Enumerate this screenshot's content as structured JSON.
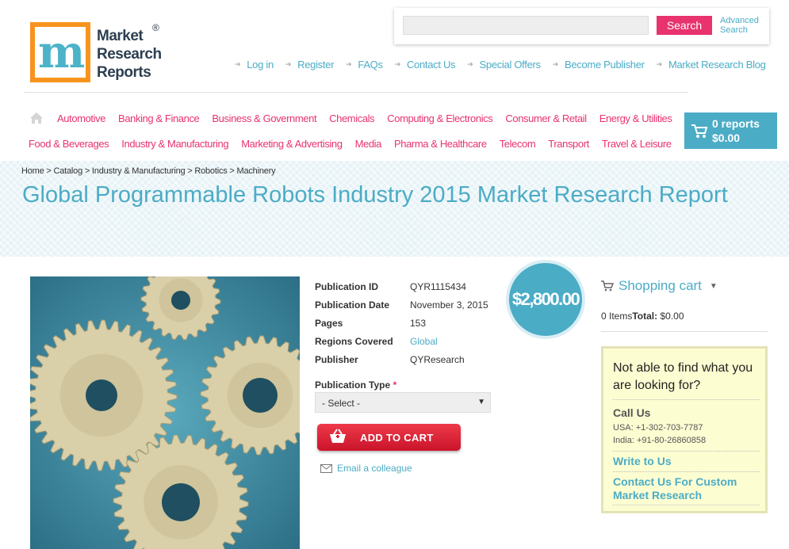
{
  "logo": {
    "text_lines": [
      "Market",
      "Research",
      "Reports"
    ],
    "registered": "®"
  },
  "search": {
    "placeholder": "",
    "button": "Search",
    "advanced": "Advanced Search"
  },
  "top_links": [
    "Log in",
    "Register",
    "FAQs",
    "Contact Us",
    "Special Offers",
    "Become Publisher",
    "Market Research Blog"
  ],
  "categories_row1": [
    "Automotive",
    "Banking & Finance",
    "Business & Government",
    "Chemicals",
    "Computing & Electronics",
    "Consumer & Retail",
    "Energy & Utilities"
  ],
  "categories_row2": [
    "Food & Beverages",
    "Industry & Manufacturing",
    "Marketing & Advertising",
    "Media",
    "Pharma & Healthcare",
    "Telecom",
    "Transport",
    "Travel & Leisure"
  ],
  "cart": {
    "reports": "0 reports",
    "total": "$0.00"
  },
  "breadcrumb": "Home > Catalog > Industry & Manufacturing > Robotics > Machinery",
  "title": "Global Programmable Robots Industry 2015 Market Research Report",
  "details": [
    {
      "label": "Publication ID",
      "value": "QYR1115434"
    },
    {
      "label": "Publication Date",
      "value": "November 3, 2015"
    },
    {
      "label": "Pages",
      "value": "153"
    },
    {
      "label": "Regions Covered",
      "value": "Global"
    },
    {
      "label": "Publisher",
      "value": "QYResearch"
    }
  ],
  "price": "$2,800.00",
  "publication_type": {
    "label": "Publication Type",
    "required": "*",
    "selected": "- Select -"
  },
  "add_to_cart": "ADD TO CART",
  "email_colleague": "Email a colleague",
  "shopping_cart": {
    "title": "Shopping cart",
    "items": "0 Items",
    "total_label": "Total:",
    "total_value": "$0.00"
  },
  "help": {
    "title": "Not able to find what you are looking for?",
    "call_us": "Call Us",
    "usa": "USA: +1-302-703-7787",
    "india": "India: +91-80-26860858",
    "write_to_us": "Write to Us",
    "custom": "Contact Us For Custom Market Research"
  },
  "colors": {
    "accent": "#4bacc6",
    "pink": "#e8336e",
    "red": "#d9232f",
    "orange": "#f7941d",
    "green": "#8cc63f"
  }
}
